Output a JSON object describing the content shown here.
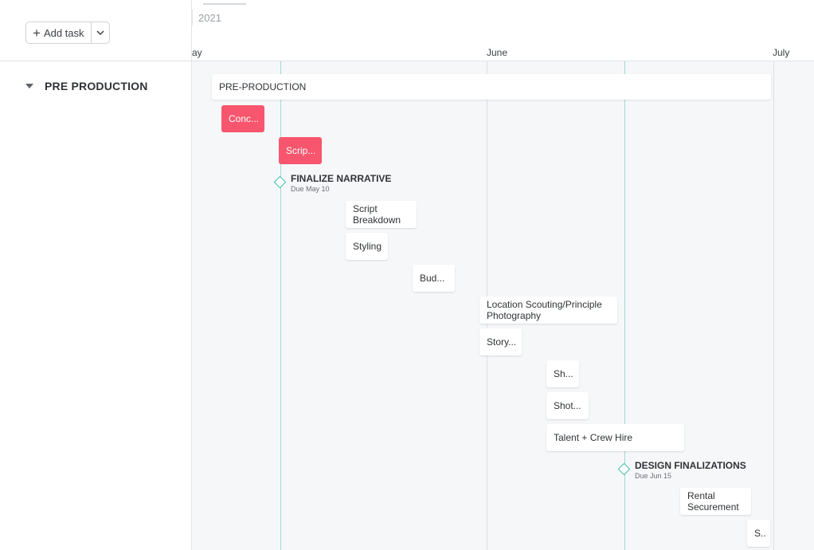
{
  "toolbar": {
    "add_task_label": "Add task",
    "plus_icon": "plus-icon",
    "dropdown_icon": "chevron-down-icon"
  },
  "sidebar": {
    "group_label": "PRE PRODUCTION",
    "collapse_icon": "caret-down-icon"
  },
  "timeline": {
    "year": "2021",
    "months": [
      "ay",
      "June",
      "July"
    ],
    "today_lines": 2
  },
  "tasks": [
    {
      "label": "PRE-PRODUCTION",
      "style": "parent"
    },
    {
      "label": "Conc...",
      "style": "pink"
    },
    {
      "label": "Scrip...",
      "style": "pink"
    },
    {
      "label": "Script\nBreakdown",
      "style": "plain"
    },
    {
      "label": "Styling",
      "style": "plain"
    },
    {
      "label": "Bud...",
      "style": "plain"
    },
    {
      "label": "Location Scouting/Principle\nPhotography",
      "style": "plain"
    },
    {
      "label": "Story...",
      "style": "plain"
    },
    {
      "label": "Sh...",
      "style": "plain"
    },
    {
      "label": "Shot...",
      "style": "plain"
    },
    {
      "label": "Talent + Crew Hire",
      "style": "plain"
    },
    {
      "label": "Rental\nSecurement",
      "style": "plain"
    },
    {
      "label": "S..",
      "style": "plain"
    }
  ],
  "milestones": [
    {
      "title": "FINALIZE NARRATIVE",
      "due": "Due May 10"
    },
    {
      "title": "DESIGN FINALIZATIONS",
      "due": "Due Jun 15"
    }
  ],
  "colors": {
    "accent_pink": "#f7566e",
    "milestone_teal": "#3bbfa5",
    "today_line": "#9fd9d3"
  }
}
